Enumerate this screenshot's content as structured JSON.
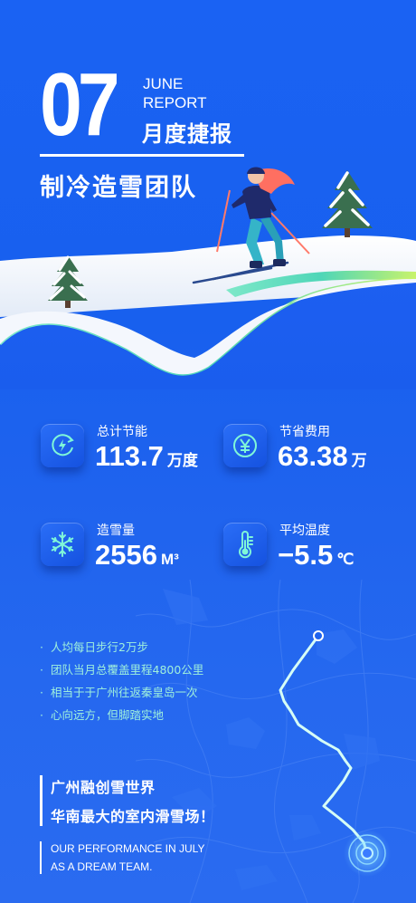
{
  "header": {
    "number": "07",
    "report_line1": "JUNE",
    "report_line2": "REPORT",
    "report_cn": "月度捷报",
    "team": "制冷造雪团队"
  },
  "stats": [
    {
      "label": "总计节能",
      "value": "113.7",
      "unit": "万度",
      "icon": "energy-recycle-icon"
    },
    {
      "label": "节省费用",
      "value": "63.38",
      "unit": "万",
      "icon": "yuan-coin-icon"
    },
    {
      "label": "造雪量",
      "value": "2556",
      "unit": "M³",
      "icon": "snowflake-icon"
    },
    {
      "label": "平均温度",
      "value": "−5.5",
      "unit": "℃",
      "icon": "thermometer-icon"
    }
  ],
  "bullets": [
    "人均每日步行2万步",
    "团队当月总覆盖里程4800公里",
    "相当于于广州往返秦皇岛一次",
    "心向远方，但脚踏实地"
  ],
  "venue": {
    "line1": "广州融创雪世界",
    "line2": "华南最大的室内滑雪场！"
  },
  "performance": {
    "line1": "OUR PERFORMANCE IN JULY",
    "line2": "AS A DREAM TEAM."
  },
  "colors": {
    "background": "#1a62f3",
    "accent_green": "#9ff0dc",
    "route_line": "#c8fff4"
  }
}
